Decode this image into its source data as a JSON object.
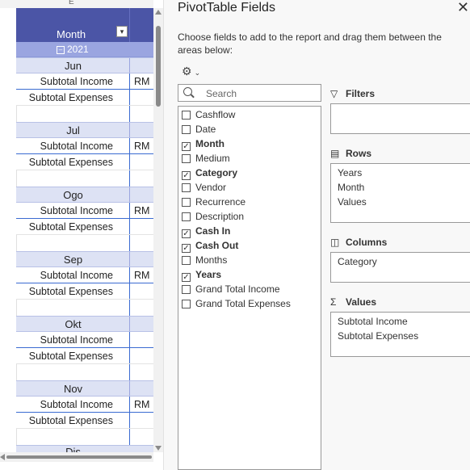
{
  "sheet": {
    "column_letter": "E",
    "header": "Month",
    "year": "2021",
    "currency": "RM",
    "months": [
      {
        "name": "Jun",
        "income": "Subtotal Income",
        "expenses": "Subtotal Expenses",
        "show_rm": true
      },
      {
        "name": "Jul",
        "income": "Subtotal Income",
        "expenses": "Subtotal Expenses",
        "show_rm": true
      },
      {
        "name": "Ogo",
        "income": "Subtotal Income",
        "expenses": "Subtotal Expenses",
        "show_rm": true
      },
      {
        "name": "Sep",
        "income": "Subtotal Income",
        "expenses": "Subtotal Expenses",
        "show_rm": true
      },
      {
        "name": "Okt",
        "income": "Subtotal Income",
        "expenses": "Subtotal Expenses",
        "show_rm": false
      },
      {
        "name": "Nov",
        "income": "Subtotal Income",
        "expenses": "Subtotal Expenses",
        "show_rm": true
      }
    ],
    "partial_month": "Dis"
  },
  "pane": {
    "title": "PivotTable Fields",
    "description": "Choose fields to add to the report and drag them between the areas below:",
    "search_placeholder": "Search",
    "fields": [
      {
        "label": "Cashflow",
        "checked": false
      },
      {
        "label": "Date",
        "checked": false
      },
      {
        "label": "Month",
        "checked": true
      },
      {
        "label": "Medium",
        "checked": false
      },
      {
        "label": "Category",
        "checked": true
      },
      {
        "label": "Vendor",
        "checked": false
      },
      {
        "label": "Recurrence",
        "checked": false
      },
      {
        "label": "Description",
        "checked": false
      },
      {
        "label": "Cash In",
        "checked": true
      },
      {
        "label": "Cash Out",
        "checked": true
      },
      {
        "label": "Months",
        "checked": false
      },
      {
        "label": "Years",
        "checked": true
      },
      {
        "label": "Grand Total Income",
        "checked": false
      },
      {
        "label": "Grand Total Expenses",
        "checked": false
      }
    ],
    "areas": {
      "filters": {
        "label": "Filters",
        "items": []
      },
      "rows": {
        "label": "Rows",
        "items": [
          "Years",
          "Month",
          "Values"
        ]
      },
      "columns": {
        "label": "Columns",
        "items": [
          "Category"
        ]
      },
      "values": {
        "label": "Values",
        "items": [
          "Subtotal Income",
          "Subtotal Expenses"
        ]
      }
    }
  }
}
